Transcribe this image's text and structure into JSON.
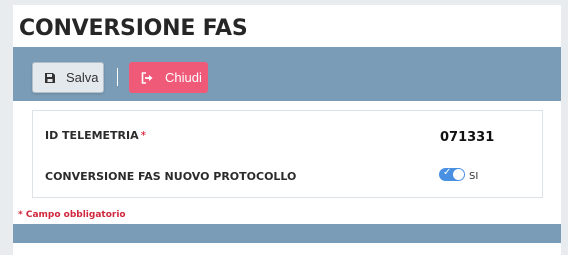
{
  "header": {
    "title": "CONVERSIONE FAS"
  },
  "toolbar": {
    "save_label": "Salva",
    "save_icon": "floppy-disk-icon",
    "close_label": "Chiudi",
    "close_icon": "sign-out-icon",
    "close_color": "#ef5a79",
    "bar_color": "#7b9cb6"
  },
  "form": {
    "fields": [
      {
        "label": "ID TELEMETRIA",
        "required_mark": "*",
        "value": "071331"
      },
      {
        "label": "CONVERSIONE FAS NUOVO PROTOCOLLO",
        "toggle_on": true,
        "toggle_text": "SI"
      }
    ],
    "required_note": "* Campo obbligatorio"
  }
}
